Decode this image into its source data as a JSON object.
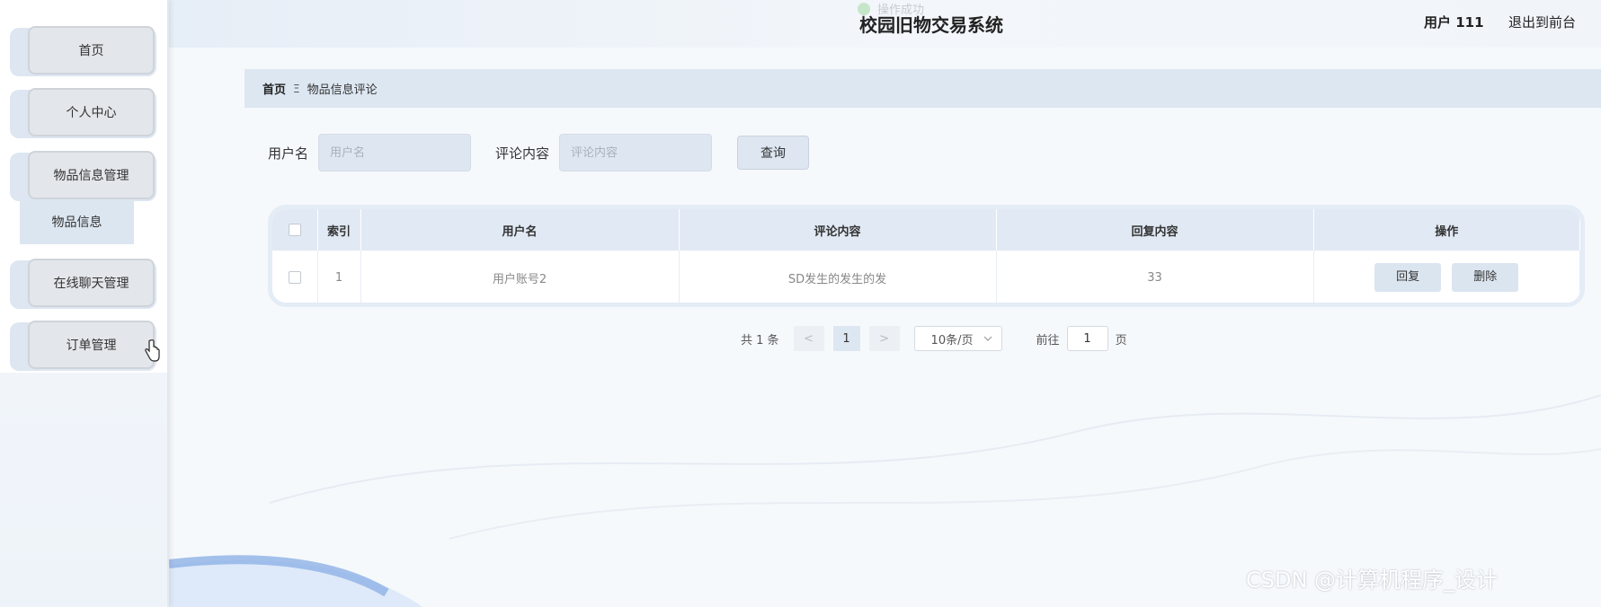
{
  "header": {
    "toast": "操作成功",
    "title": "校园旧物交易系统",
    "user": "用户 111",
    "logout": "退出到前台"
  },
  "sidebar": {
    "items": [
      {
        "label": "首页"
      },
      {
        "label": "个人中心"
      },
      {
        "label": "物品信息管理"
      },
      {
        "label": "在线聊天管理"
      },
      {
        "label": "订单管理"
      }
    ],
    "submenu": {
      "label": "物品信息"
    }
  },
  "breadcrumb": {
    "home": "首页",
    "separator": "Ξ",
    "current": "物品信息评论"
  },
  "search": {
    "username_label": "用户名",
    "username_placeholder": "用户名",
    "comment_label": "评论内容",
    "comment_placeholder": "评论内容",
    "button": "查询"
  },
  "table": {
    "headers": {
      "index": "索引",
      "username": "用户名",
      "comment": "评论内容",
      "reply": "回复内容",
      "actions": "操作"
    },
    "rows": [
      {
        "index": "1",
        "username": "用户账号2",
        "comment": "SD发生的发生的发",
        "reply": "33",
        "reply_btn": "回复",
        "delete_btn": "删除"
      }
    ]
  },
  "pagination": {
    "total": "共 1 条",
    "prev": "<",
    "page": "1",
    "next": ">",
    "page_size": "10条/页",
    "goto_label": "前往",
    "goto_value": "1",
    "goto_suffix": "页"
  },
  "watermark": "CSDN @计算机程序_设计",
  "colors": {
    "accent": "#dde7f2",
    "sidebar_button": "#e3e6ea"
  }
}
